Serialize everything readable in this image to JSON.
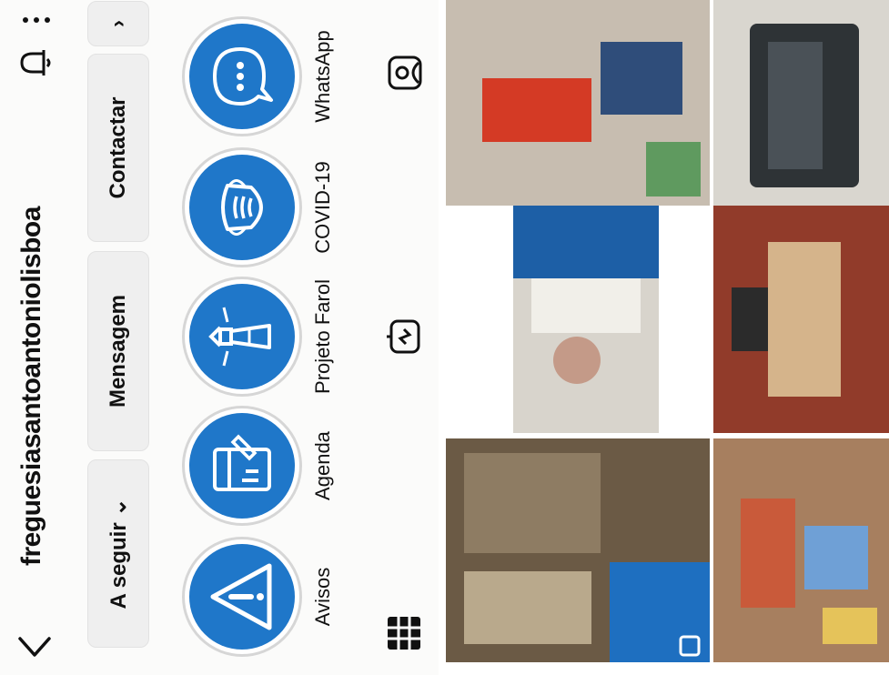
{
  "header": {
    "username": "freguesiasantoantoniolisboa",
    "back_icon": "chevron-left-icon",
    "bell_icon": "bell-icon",
    "more_icon": "more-vertical-icon"
  },
  "actions": {
    "follow_label": "A seguir ⌄",
    "message_label": "Mensagem",
    "contact_label": "Contactar",
    "more_label": "›"
  },
  "highlights": [
    {
      "label": "Avisos",
      "icon": "warning-icon"
    },
    {
      "label": "Agenda",
      "icon": "agenda-icon"
    },
    {
      "label": "Projeto Farol",
      "icon": "lighthouse-icon"
    },
    {
      "label": "COVID-19",
      "icon": "mask-icon"
    },
    {
      "label": "WhatsApp",
      "icon": "chat-icon"
    }
  ],
  "tabs": [
    {
      "name": "grid",
      "icon": "grid-icon",
      "selected": true
    },
    {
      "name": "reels",
      "icon": "reels-icon",
      "selected": false
    },
    {
      "name": "tagged",
      "icon": "tagged-icon",
      "selected": false
    }
  ],
  "colors": {
    "accent": "#1f77c9",
    "background": "#fbfbfa",
    "button": "#efefef"
  }
}
